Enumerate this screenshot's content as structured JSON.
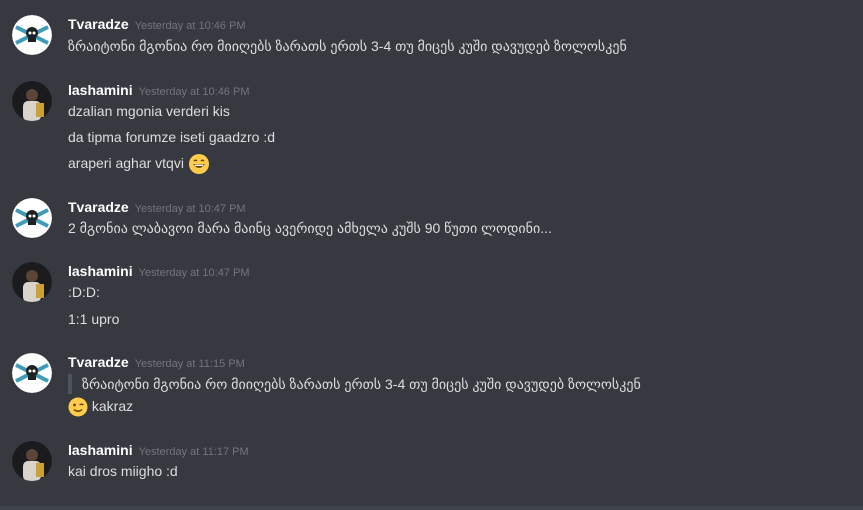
{
  "messages": [
    {
      "author": "Tvaradze",
      "timestamp": "Yesterday at 10:46 PM",
      "lines": [
        "ზრაიტონი მგონია რო მიიღებს ზარათს ერთს 3-4 თუ მიცეს კუში დავუდებ ზოლოსკენ"
      ]
    },
    {
      "author": "lashamini",
      "timestamp": "Yesterday at 10:46 PM",
      "lines": [
        "dzalian mgonia verderi kis",
        "da tipma forumze iseti gaadzro :d",
        "araperi aghar vtqvi"
      ],
      "emoji_name": "grinning-face-emoji"
    },
    {
      "author": "Tvaradze",
      "timestamp": "Yesterday at 10:47 PM",
      "lines": [
        "2 მგონია ლაბავოი მარა მაინც ავერიდე ამხელა კუშს 90 წუთი ლოდინი..."
      ]
    },
    {
      "author": "lashamini",
      "timestamp": "Yesterday at 10:47 PM",
      "lines": [
        ":D:D:",
        "1:1 upro"
      ]
    },
    {
      "author": "Tvaradze",
      "timestamp": "Yesterday at 11:15 PM",
      "quote": "ზრაიტონი მგონია რო მიიღებს ზარათს ერთს 3-4 თუ მიცეს კუში დავუდებ ზოლოსკენ",
      "lines": [
        "kakraz"
      ],
      "emoji_name": "winking-face-emoji"
    },
    {
      "author": "lashamini",
      "timestamp": "Yesterday at 11:17 PM",
      "lines": [
        "kai dros miigho :d"
      ]
    }
  ],
  "colors": {
    "background": "#36393f",
    "username": "#ffffff",
    "timestamp": "#72767d",
    "text": "#dcddde",
    "quote_bar": "#4f545c"
  }
}
